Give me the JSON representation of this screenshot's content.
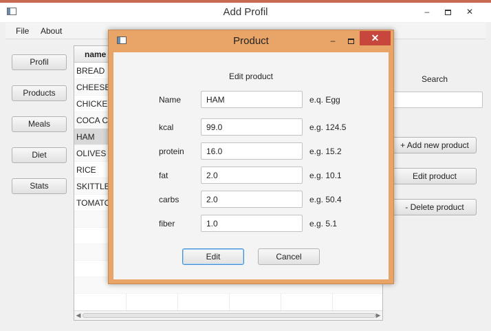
{
  "window": {
    "title": "Add Profil"
  },
  "menu": {
    "file": "File",
    "about": "About"
  },
  "nav": [
    "Profil",
    "Products",
    "Meals",
    "Diet",
    "Stats"
  ],
  "table": {
    "column_header": "name",
    "rows": [
      "BREAD",
      "CHEESE",
      "CHICKEN",
      "COCA COLA",
      "HAM",
      "OLIVES",
      "RICE",
      "SKITTLES",
      "TOMATO"
    ],
    "selected_index": 4
  },
  "search": {
    "label": "Search",
    "value": ""
  },
  "actions": {
    "add": "+ Add new product",
    "edit": "Edit product",
    "delete": "- Delete product"
  },
  "dialog": {
    "title": "Product",
    "heading": "Edit product",
    "fields": [
      {
        "label": "Name",
        "value": "HAM",
        "hint": "e.q. Egg"
      },
      {
        "label": "kcal",
        "value": "99.0",
        "hint": "e.g. 124.5"
      },
      {
        "label": "protein",
        "value": "16.0",
        "hint": "e.g. 15.2"
      },
      {
        "label": "fat",
        "value": "2.0",
        "hint": "e.g. 10.1"
      },
      {
        "label": "carbs",
        "value": "2.0",
        "hint": "e.g. 50.4"
      },
      {
        "label": "fiber",
        "value": "1.0",
        "hint": "e.g. 5.1"
      }
    ],
    "edit_button": "Edit",
    "cancel_button": "Cancel"
  },
  "colors": {
    "dialog_frame": "#e9a567",
    "close_button": "#c7473c",
    "accent": "#3d8fd6"
  }
}
